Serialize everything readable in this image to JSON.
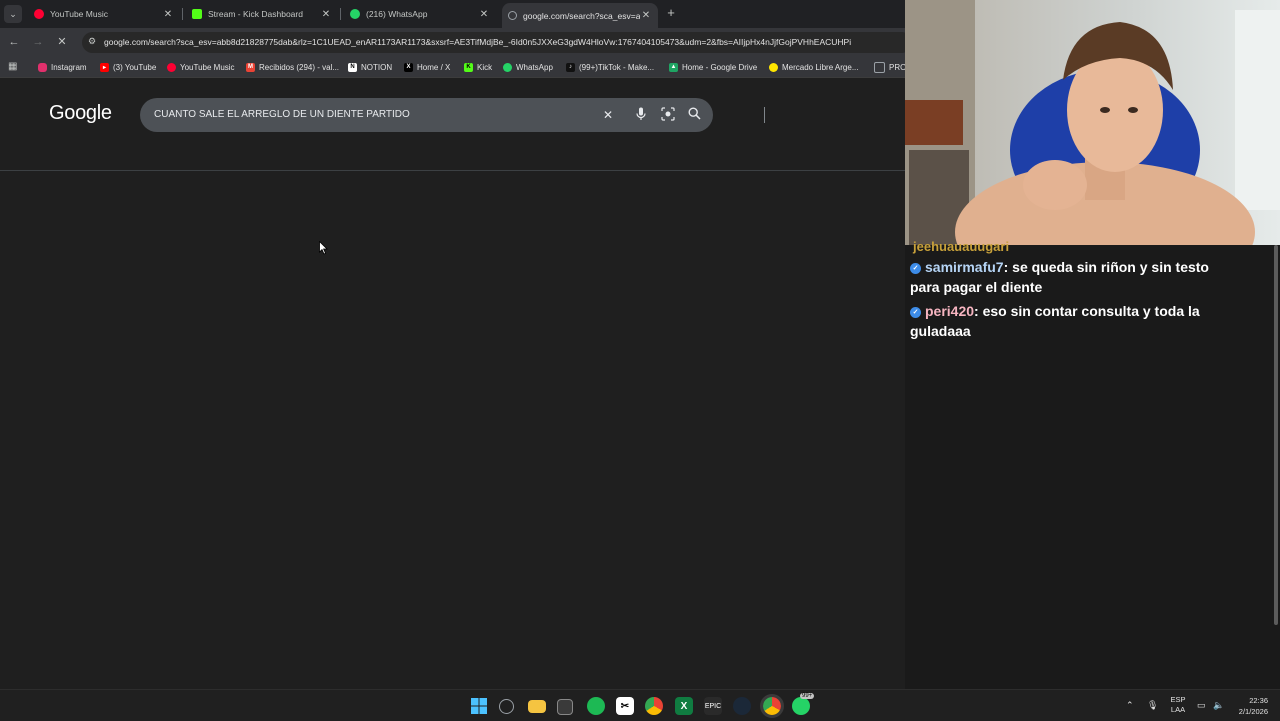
{
  "tabs": [
    {
      "title": "YouTube Music",
      "icon": "youtube-music-icon",
      "color": "#ff0033"
    },
    {
      "title": "Stream - Kick Dashboard",
      "icon": "kick-icon",
      "color": "#53fc18"
    },
    {
      "title": "(216) WhatsApp",
      "icon": "whatsapp-icon",
      "color": "#25d366"
    },
    {
      "title": "google.com/search?sca_esv=ab",
      "icon": "google-icon",
      "color": "#9aa0a6"
    }
  ],
  "address_bar": {
    "url": "google.com/search?sca_esv=abb8d21828775dab&rlz=1C1UEAD_enAR1173AR1173&sxsrf=AE3TifMdjBe_-6Id0n5JXXeG3gdW4HloVw:1767404105473&udm=2&fbs=AIIjpHx4nJjfGojPVHhEACUHPi"
  },
  "bookmarks": [
    {
      "label": "Instagram",
      "color": "#e1306c"
    },
    {
      "label": "(3) YouTube",
      "color": "#ff0000"
    },
    {
      "label": "YouTube Music",
      "color": "#ff0033"
    },
    {
      "label": "Recibidos (294) - val...",
      "color": "#ea4335"
    },
    {
      "label": "NOTION",
      "color": "#ffffff"
    },
    {
      "label": "Home / X",
      "color": "#000000"
    },
    {
      "label": "Kick",
      "color": "#53fc18"
    },
    {
      "label": "WhatsApp",
      "color": "#25d366"
    },
    {
      "label": "(99+)TikTok - Make...",
      "color": "#111111"
    },
    {
      "label": "Home - Google Drive",
      "color": "#1fa463"
    },
    {
      "label": "Mercado Libre Arge...",
      "color": "#ffe600"
    },
    {
      "label": "PRO",
      "color": "#9aa0a6"
    }
  ],
  "google": {
    "logo": "Google",
    "query": "CUANTO SALE EL ARREGLO DE UN DIENTE PARTIDO"
  },
  "chat": {
    "cut_line": "jeehuauauugari",
    "messages": [
      {
        "user": "samirmafu7",
        "text": "se queda sin riñon y sin testo para pagar el diente"
      },
      {
        "user": "peri420",
        "text": "eso sin contar consulta y toda la guladaaa"
      }
    ]
  },
  "taskbar": {
    "badge": "99+",
    "language": "ESP",
    "language_sub": "LAA",
    "time": "22:36",
    "date": "2/1/2026"
  }
}
